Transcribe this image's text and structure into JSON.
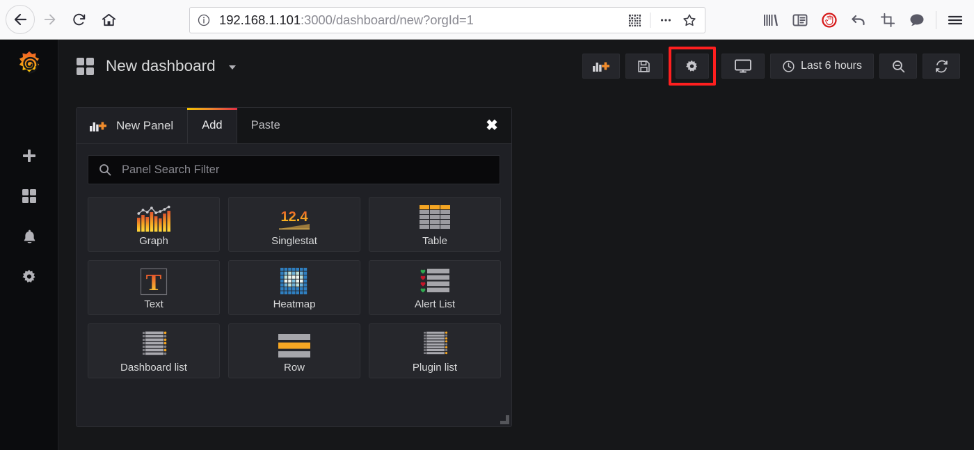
{
  "browser": {
    "nav": {
      "back": "back-arrow",
      "forward": "forward-arrow",
      "reload": "reload",
      "home": "home"
    },
    "url": {
      "host": "192.168.1.101",
      "path": ":3000/dashboard/new?orgId=1",
      "full": "192.168.1.101:3000/dashboard/new?orgId=1",
      "info_icon": "info-circle-icon",
      "qr_icon": "qr-code-icon",
      "more_icon": "ellipsis-icon",
      "bookmark_icon": "star-icon"
    },
    "right_icons": [
      "library-icon",
      "sidebar-toggle-icon",
      "adblock-icon",
      "undo-icon",
      "screenshot-icon",
      "chat-bubble-icon",
      "hamburger-menu-icon"
    ]
  },
  "sidebar": {
    "logo": "grafana-logo",
    "items": [
      {
        "icon": "plus-icon",
        "name": "create"
      },
      {
        "icon": "dashboards-icon",
        "name": "dashboards"
      },
      {
        "icon": "bell-icon",
        "name": "alerting"
      },
      {
        "icon": "gear-icon",
        "name": "configuration"
      }
    ]
  },
  "header": {
    "title": "New dashboard",
    "grid_icon": "dashboard-grid-icon",
    "caret_icon": "chevron-down-icon",
    "toolbar": {
      "add_panel": {
        "label": "",
        "icon": "add-panel-icon"
      },
      "save": {
        "label": "",
        "icon": "save-floppy-icon"
      },
      "settings": {
        "label": "",
        "icon": "gear-icon",
        "highlighted": true,
        "highlight_color": "#ff1f1f"
      },
      "tv_mode": {
        "label": "",
        "icon": "monitor-icon"
      },
      "time_range": {
        "label": "Last 6 hours",
        "icon": "clock-icon"
      },
      "zoom_out": {
        "label": "",
        "icon": "search-minus-icon"
      },
      "refresh": {
        "label": "",
        "icon": "refresh-icon"
      }
    }
  },
  "add_panel": {
    "title": "New Panel",
    "title_icon": "add-panel-icon",
    "tabs": [
      {
        "label": "Add",
        "active": true
      },
      {
        "label": "Paste",
        "active": false
      }
    ],
    "close_label": "✖",
    "search": {
      "placeholder": "Panel Search Filter",
      "value": "",
      "icon": "search-icon"
    },
    "panel_types": [
      {
        "label": "Graph",
        "icon": "graph-icon"
      },
      {
        "label": "Singlestat",
        "icon": "singlestat-icon",
        "sample_value": "12.4"
      },
      {
        "label": "Table",
        "icon": "table-icon"
      },
      {
        "label": "Text",
        "icon": "text-icon",
        "glyph": "T"
      },
      {
        "label": "Heatmap",
        "icon": "heatmap-icon"
      },
      {
        "label": "Alert List",
        "icon": "alert-list-icon"
      },
      {
        "label": "Dashboard list",
        "icon": "dashboard-list-icon"
      },
      {
        "label": "Row",
        "icon": "row-icon"
      },
      {
        "label": "Plugin list",
        "icon": "plugin-list-icon"
      }
    ],
    "resize_handle": "resize-handle"
  },
  "colors": {
    "accent_orange": "#ef8b2c",
    "accent_yellow": "#f2c200",
    "accent_red": "#e02f44",
    "highlight_red": "#ff1f1f",
    "panel_bg": "#1f2025",
    "page_bg": "#161719"
  }
}
